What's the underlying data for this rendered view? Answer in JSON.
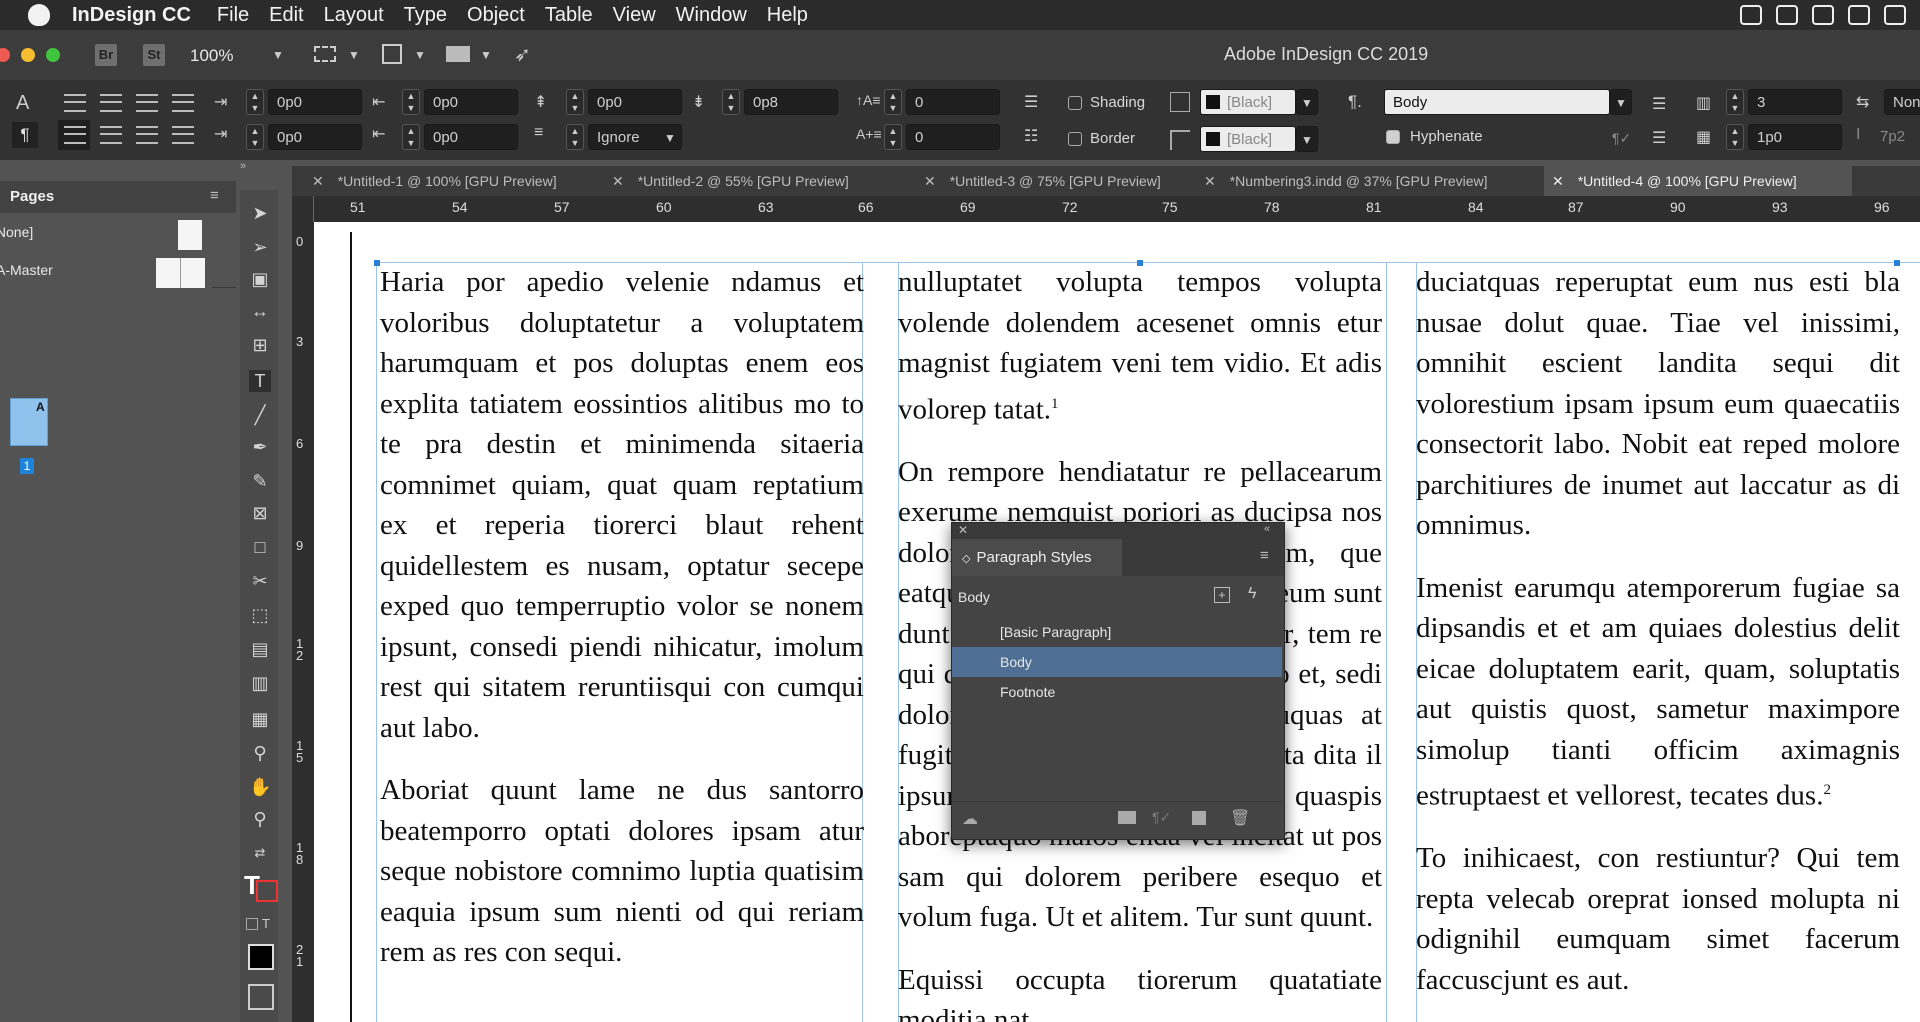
{
  "menubar": {
    "app": "InDesign CC",
    "items": [
      "File",
      "Edit",
      "Layout",
      "Type",
      "Object",
      "Table",
      "View",
      "Window",
      "Help"
    ]
  },
  "appbar": {
    "bridge_label": "Br",
    "stock_label": "St",
    "zoom": "100%",
    "title": "Adobe InDesign CC 2019"
  },
  "control": {
    "left_indent": "0p0",
    "right_indent": "0p0",
    "first_line_indent": "0p0",
    "last_line_indent": "0p0",
    "space_before": "0p0",
    "space_after": "0p8",
    "drop_cap_lines": "0",
    "drop_cap_chars": "0",
    "align_grid": "Ignore",
    "shading_label": "Shading",
    "border_label": "Border",
    "shading_color": "[Black]",
    "border_color": "[Black]",
    "paragraph_style": "Body",
    "hyphenate_label": "Hyphenate",
    "columns": "3",
    "gutter": "1p0",
    "span_value": "None",
    "span_value2": "7p2"
  },
  "pages_panel": {
    "title": "Pages",
    "none_label": "[None]",
    "master_label": "A-Master",
    "page_number": "1",
    "page_master_letter": "A"
  },
  "tabs": [
    "*Untitled-1 @ 100% [GPU Preview]",
    "*Untitled-2 @ 55% [GPU Preview]",
    "*Untitled-3 @ 75% [GPU Preview]",
    "*Numbering3.indd @ 37% [GPU Preview]",
    "*Untitled-4 @ 100% [GPU Preview]"
  ],
  "ruler": {
    "h_labels": [
      "51",
      "54",
      "57",
      "60",
      "63",
      "66",
      "69",
      "72",
      "75",
      "78",
      "81",
      "84",
      "87",
      "90",
      "93",
      "96"
    ],
    "v_labels": [
      "0",
      "3",
      "6",
      "9",
      "12",
      "15",
      "18",
      "21"
    ]
  },
  "document": {
    "col1": [
      "Haria por apedio velenie ndamus et voloribus doluptatetur a voluptatem harumquam et pos doluptas enem eos explita tatiatem eossintios alitibus mo to te pra destin et minimenda sitaeria comnimet quiam, quat quam reptatium ex et reperia tiorerci blaut rehent quidellestem es nusam, optatur secepe exped quo temperruptio volor se nonem ipsunt, consedi piendi nihicatur, imolum rest qui sitatem reruntiisqui con cumqui aut labo.",
      "Aboriat quunt lame ne dus santorro beatemporro optati dolores ipsam atur seque nobistore comnimo luptia quatisim eaquia ipsum sum nienti od qui reriam rem as res con sequi."
    ],
    "col2": [
      "nulluptatet volupta tempos volupta volende dolendem acesenet omnis etur magnist fugiatem veni tem vidio. Et adis volorep tatat.",
      "On rempore hendiatatur re pellacearum exerume nemquist poriori as ducipsa nos dolorem volupit vero int eum, que eatquiae sitam ra dolut mporaes eum sunt dunt in rehent ratur, ipsam ioratur, tem re qui quos as eniscipsandis dus mo et, sedi doloria ius apicimi cullorem uquas at fugiti nemporem nonseque solupta dita il ipsum ullum qui tem quaspis aboreptaquo maios enda vel incitat ut pos sam qui dolorem peribere esequo et volum fuga. Ut et alitem. Tur sunt quunt.",
      "Equissi occupta tiorerum quatatiate moditia nat."
    ],
    "col2_footnote_ref": "1",
    "col3": [
      "duciatquas reperuptat eum nus esti bla nusae dolut quae. Tiae vel inissimi, omnihit escient landita sequi dit volorestium ipsam ipsum eum quaecatiis consectorit labo. Nobit eat reped molore parchitiures de inumet aut laccatur as di omnimus.",
      "Imenist earumqu atemporerum fugiae sa dipsandis et et am quiaes dolestius delit eicae doluptatem earit, quam, soluptatis aut quistis quost, sametur maximpore simolup tianti officim aximagnis estruptaest et vellorest, tecates dus.",
      "To inihicaest, con restiuntur? Qui tem repta velecab oreprat ionsed molupta ni odignihil eumquam simet facerum faccuscjunt es aut."
    ],
    "col3_footnote_ref": "2"
  },
  "paragraph_styles_panel": {
    "title": "Paragraph Styles",
    "current": "Body",
    "items": [
      "[Basic Paragraph]",
      "Body",
      "Footnote"
    ],
    "selected_index": 1
  }
}
